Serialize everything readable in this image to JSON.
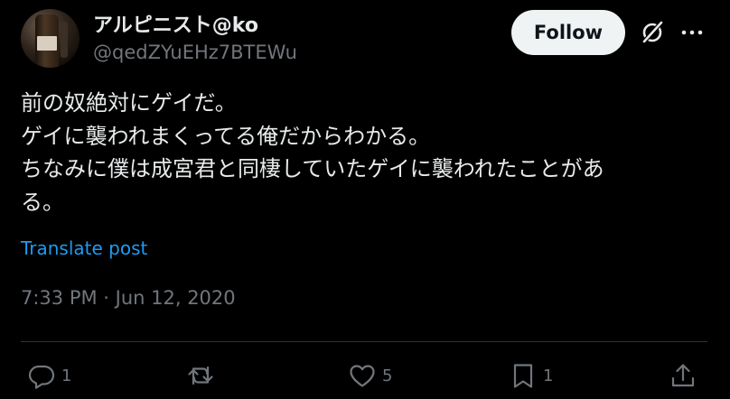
{
  "author": {
    "display_name": "アルピニスト@ko",
    "handle": "@qedZYuEHz7BTEWu"
  },
  "follow_label": "Follow",
  "tweet": {
    "lines": [
      "前の奴絶対にゲイだ。",
      "ゲイに襲われまくってる俺だからわかる。",
      "ちなみに僕は成宮君と同棲していたゲイに襲われたことがあ",
      "る。"
    ],
    "translate_label": "Translate post",
    "timestamp": "7:33 PM · Jun 12, 2020"
  },
  "actions": {
    "reply_count": "1",
    "retweet_count": "",
    "like_count": "5",
    "bookmark_count": "1"
  },
  "icons": {
    "grok": "grok-icon",
    "more": "more-icon",
    "reply": "reply-icon",
    "retweet": "retweet-icon",
    "like": "heart-icon",
    "bookmark": "bookmark-icon",
    "share": "share-icon"
  },
  "colors": {
    "background": "#000000",
    "text_primary": "#e7e9ea",
    "text_secondary": "#71767b",
    "link": "#1d9bf0",
    "follow_bg": "#eff3f4",
    "divider": "#2f3336"
  }
}
